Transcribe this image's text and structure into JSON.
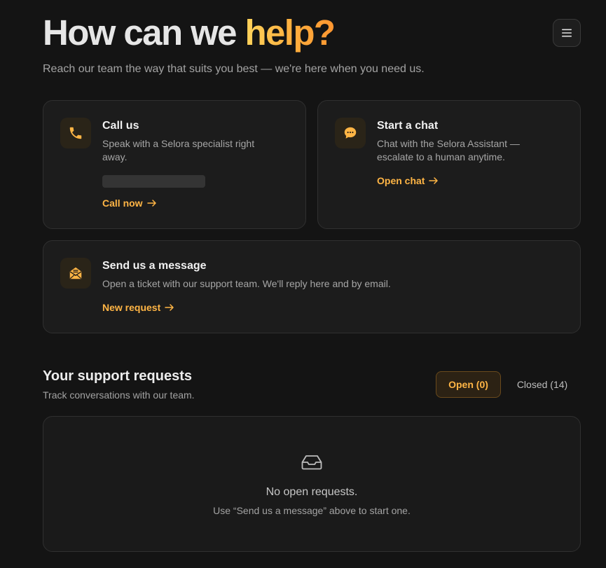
{
  "hero": {
    "title_main": "How can we ",
    "title_accent": "help?",
    "subtitle": "Reach our team the way that suits you best — we're here when you need us."
  },
  "menu": {
    "icon": "hamburger-icon"
  },
  "contact_options": {
    "call": {
      "icon": "phone-icon",
      "title": "Call us",
      "description": "Speak with a Selora specialist right away.",
      "link_label": "Call now"
    },
    "chat": {
      "icon": "chat-bubble-icon",
      "title": "Start a chat",
      "description": "Chat with the Selora Assistant — escalate to a human anytime.",
      "link_label": "Open chat"
    },
    "message": {
      "icon": "envelope-icon",
      "title": "Send us a message",
      "description": "Open a ticket with our support team. We'll reply here and by email.",
      "link_label": "New request"
    }
  },
  "requests": {
    "title": "Your support requests",
    "subtitle": "Track conversations with our team.",
    "tabs": [
      {
        "label": "Open (0)",
        "active": true
      },
      {
        "label": "Closed (14)",
        "active": false
      }
    ],
    "empty": {
      "icon": "inbox-icon",
      "title": "No open requests.",
      "hint": "Use “Send us a message” above to start one."
    }
  },
  "colors": {
    "background": "#141414",
    "card": "#1c1c1c",
    "accent": "#ffb545",
    "accent_gradient_start": "#ffd35c",
    "accent_gradient_end": "#ff9630"
  }
}
